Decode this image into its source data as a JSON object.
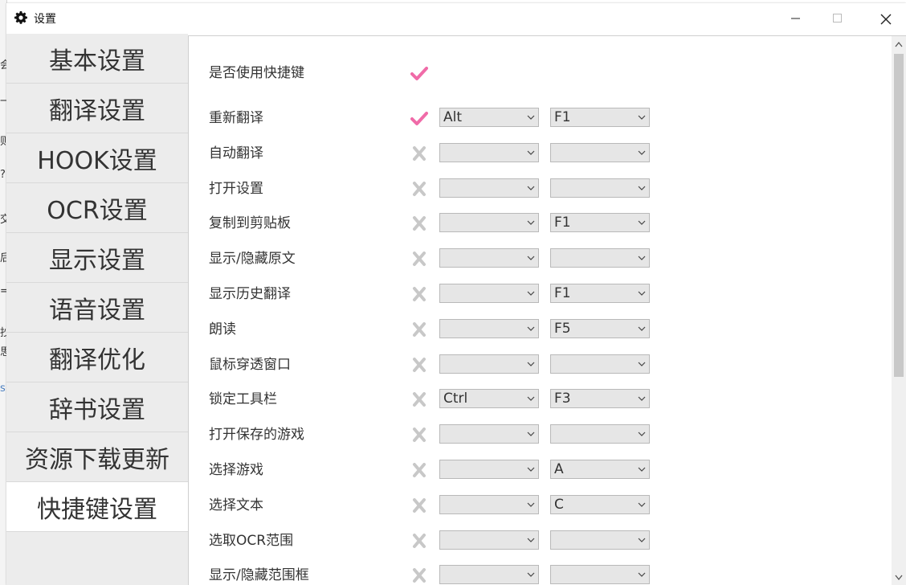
{
  "window": {
    "title": "设置"
  },
  "colors": {
    "check": "#f06ba8",
    "cross": "#c8c8c8",
    "accent_bg": "#ececec"
  },
  "background_app": {
    "fragments": [
      "会",
      "一",
      "则",
      "?",
      "交",
      "后",
      "=",
      "抄",
      "思",
      "s"
    ]
  },
  "sidebar": {
    "items": [
      {
        "label": "基本设置",
        "active": false
      },
      {
        "label": "翻译设置",
        "active": false
      },
      {
        "label": "HOOK设置",
        "active": false
      },
      {
        "label": "OCR设置",
        "active": false
      },
      {
        "label": "显示设置",
        "active": false
      },
      {
        "label": "语音设置",
        "active": false
      },
      {
        "label": "翻译优化",
        "active": false
      },
      {
        "label": "辞书设置",
        "active": false
      },
      {
        "label": "资源下载更新",
        "active": false
      },
      {
        "label": "快捷键设置",
        "active": true
      }
    ]
  },
  "master": {
    "label": "是否使用快捷键",
    "enabled": true
  },
  "hotkeys": [
    {
      "label": "重新翻译",
      "enabled": true,
      "key1": "Alt",
      "key2": "F1"
    },
    {
      "label": "自动翻译",
      "enabled": false,
      "key1": "",
      "key2": ""
    },
    {
      "label": "打开设置",
      "enabled": false,
      "key1": "",
      "key2": ""
    },
    {
      "label": "复制到剪贴板",
      "enabled": false,
      "key1": "",
      "key2": "F1"
    },
    {
      "label": "显示/隐藏原文",
      "enabled": false,
      "key1": "",
      "key2": ""
    },
    {
      "label": "显示历史翻译",
      "enabled": false,
      "key1": "",
      "key2": "F1"
    },
    {
      "label": "朗读",
      "enabled": false,
      "key1": "",
      "key2": "F5"
    },
    {
      "label": "鼠标穿透窗口",
      "enabled": false,
      "key1": "",
      "key2": ""
    },
    {
      "label": "锁定工具栏",
      "enabled": false,
      "key1": "Ctrl",
      "key2": "F3"
    },
    {
      "label": "打开保存的游戏",
      "enabled": false,
      "key1": "",
      "key2": ""
    },
    {
      "label": "选择游戏",
      "enabled": false,
      "key1": "",
      "key2": "A"
    },
    {
      "label": "选择文本",
      "enabled": false,
      "key1": "",
      "key2": "C"
    },
    {
      "label": "选取OCR范围",
      "enabled": false,
      "key1": "",
      "key2": ""
    },
    {
      "label": "显示/隐藏范围框",
      "enabled": false,
      "key1": "",
      "key2": ""
    }
  ]
}
